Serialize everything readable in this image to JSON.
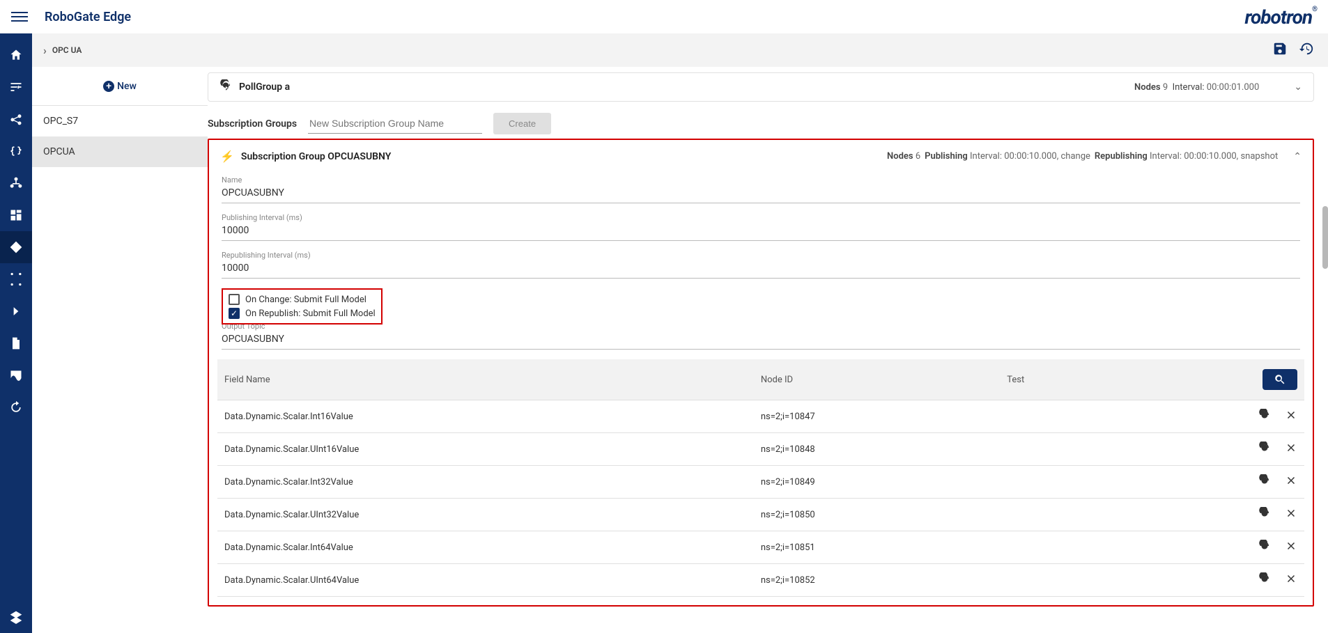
{
  "app_title": "RoboGate Edge",
  "brand": "robotron",
  "breadcrumb": "OPC UA",
  "new_label": "New",
  "sidebar": {
    "items": [
      {
        "label": "OPC_S7",
        "active": false
      },
      {
        "label": "OPCUA",
        "active": true
      }
    ]
  },
  "poll_group": {
    "title": "PollGroup a",
    "nodes_label": "Nodes",
    "nodes_count": "9",
    "interval_label": "Interval:",
    "interval": "00:00:01.000"
  },
  "subscription_section": {
    "heading": "Subscription Groups",
    "placeholder": "New Subscription Group Name",
    "create_label": "Create"
  },
  "sg": {
    "title": "Subscription Group OPCUASUBNY",
    "nodes_label": "Nodes",
    "nodes_count": "6",
    "pub_label": "Publishing",
    "pub_interval_label": "Interval:",
    "pub_interval": "00:00:10.000, change",
    "repub_label": "Republishing",
    "repub_interval_label": "Interval:",
    "repub_interval": "00:00:10.000, snapshot",
    "fields": {
      "name_label": "Name",
      "name_value": "OPCUASUBNY",
      "pub_int_label": "Publishing Interval (ms)",
      "pub_int_value": "10000",
      "repub_int_label": "Republishing Interval (ms)",
      "repub_int_value": "10000",
      "on_change_label": "On Change: Submit Full Model",
      "on_republish_label": "On Republish: Submit Full Model",
      "output_topic_label": "Output Topic",
      "output_topic_value": "OPCUASUBNY"
    },
    "table": {
      "col_field": "Field Name",
      "col_node": "Node ID",
      "col_test": "Test",
      "rows": [
        {
          "field": "Data.Dynamic.Scalar.Int16Value",
          "node": "ns=2;i=10847"
        },
        {
          "field": "Data.Dynamic.Scalar.UInt16Value",
          "node": "ns=2;i=10848"
        },
        {
          "field": "Data.Dynamic.Scalar.Int32Value",
          "node": "ns=2;i=10849"
        },
        {
          "field": "Data.Dynamic.Scalar.UInt32Value",
          "node": "ns=2;i=10850"
        },
        {
          "field": "Data.Dynamic.Scalar.Int64Value",
          "node": "ns=2;i=10851"
        },
        {
          "field": "Data.Dynamic.Scalar.UInt64Value",
          "node": "ns=2;i=10852"
        }
      ]
    }
  }
}
